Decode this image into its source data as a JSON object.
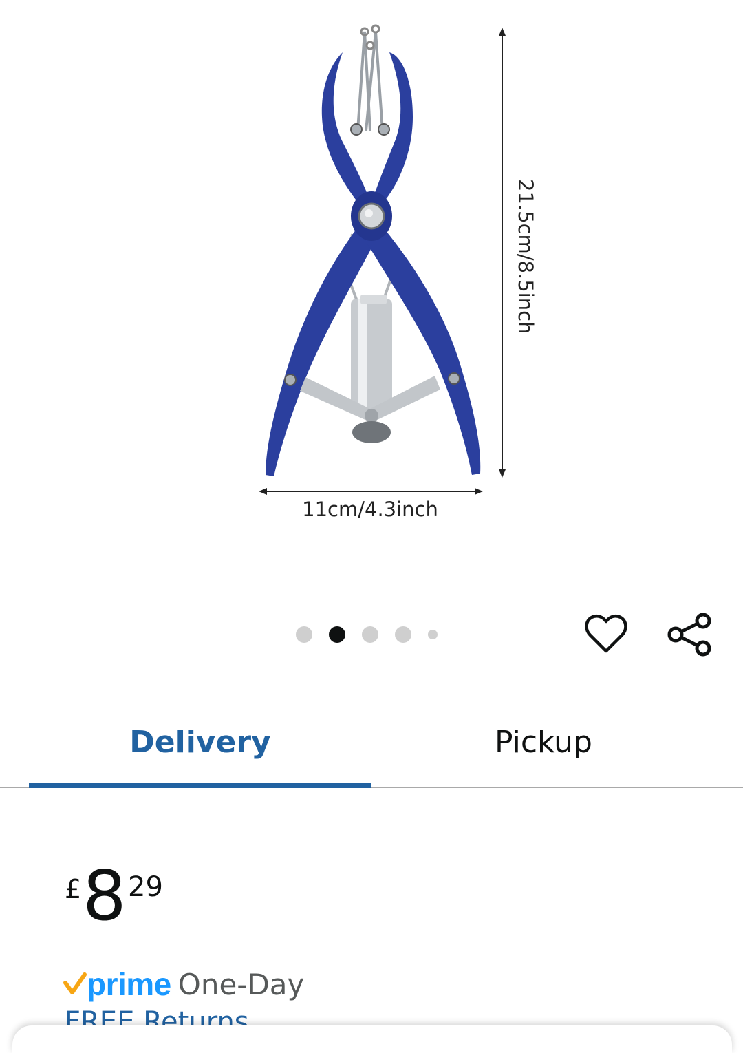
{
  "product_image": {
    "height_label": "21.5cm/8.5inch",
    "width_label": "11cm/4.3inch",
    "product_color": "#2b3f9e"
  },
  "carousel": {
    "count": 5,
    "active_index": 1
  },
  "actions": {
    "wishlist_icon": "heart-outline-icon",
    "share_icon": "share-icon"
  },
  "tabs": [
    {
      "label": "Delivery",
      "selected": true
    },
    {
      "label": "Pickup",
      "selected": false
    }
  ],
  "price": {
    "currency": "£",
    "whole": "8",
    "fraction": "29"
  },
  "prime": {
    "brand": "prime",
    "speed": "One-Day"
  },
  "returns": {
    "label": "FREE Returns"
  },
  "colors": {
    "link_blue": "#2162a1",
    "prime_blue": "#1a98ff",
    "prime_check": "#f7a614"
  }
}
